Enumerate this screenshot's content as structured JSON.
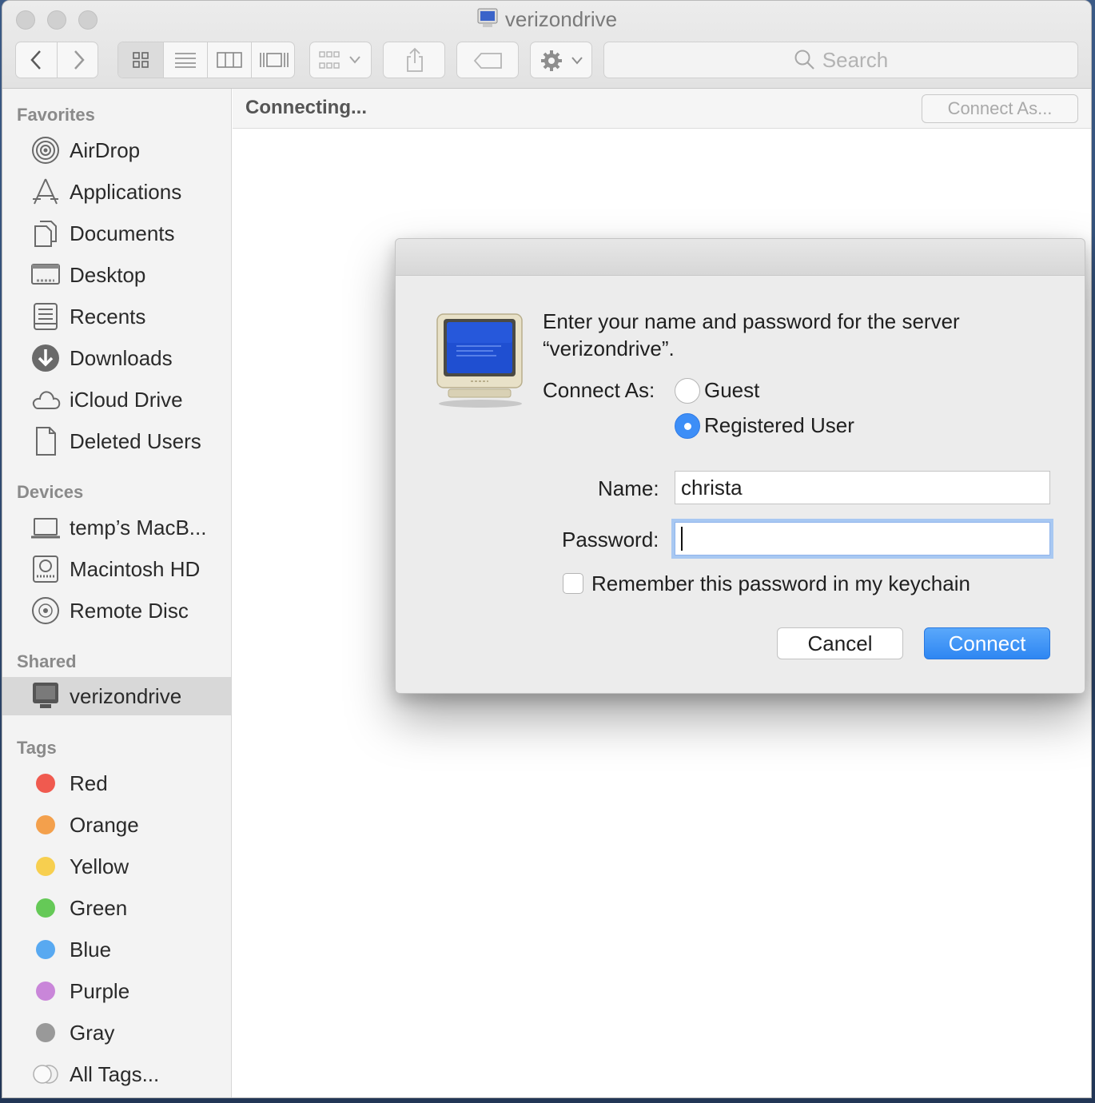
{
  "window": {
    "title": "verizondrive"
  },
  "toolbar": {
    "search_placeholder": "Search"
  },
  "sidebar": {
    "favorites_header": "Favorites",
    "favorites": [
      {
        "label": "AirDrop",
        "icon": "airdrop-icon"
      },
      {
        "label": "Applications",
        "icon": "applications-icon"
      },
      {
        "label": "Documents",
        "icon": "documents-icon"
      },
      {
        "label": "Desktop",
        "icon": "desktop-icon"
      },
      {
        "label": "Recents",
        "icon": "recents-icon"
      },
      {
        "label": "Downloads",
        "icon": "downloads-icon"
      },
      {
        "label": "iCloud Drive",
        "icon": "icloud-icon"
      },
      {
        "label": "Deleted Users",
        "icon": "document-icon"
      }
    ],
    "devices_header": "Devices",
    "devices": [
      {
        "label": "temp’s MacB...",
        "icon": "laptop-icon"
      },
      {
        "label": "Macintosh HD",
        "icon": "hard-drive-icon"
      },
      {
        "label": "Remote Disc",
        "icon": "disc-icon"
      }
    ],
    "shared_header": "Shared",
    "shared": [
      {
        "label": "verizondrive",
        "icon": "monitor-icon",
        "selected": true
      }
    ],
    "tags_header": "Tags",
    "tags": [
      {
        "label": "Red",
        "color": "#f05a4f"
      },
      {
        "label": "Orange",
        "color": "#f3a04c"
      },
      {
        "label": "Yellow",
        "color": "#f7cf4f"
      },
      {
        "label": "Green",
        "color": "#65c957"
      },
      {
        "label": "Blue",
        "color": "#58a9f1"
      },
      {
        "label": "Purple",
        "color": "#c986d9"
      },
      {
        "label": "Gray",
        "color": "#999999"
      },
      {
        "label": "All Tags...",
        "color": ""
      }
    ]
  },
  "pathbar": {
    "status": "Connecting...",
    "connect_as_button": "Connect As..."
  },
  "dialog": {
    "prompt_line1": "Enter your name and password for the server",
    "prompt_line2": "“verizondrive”.",
    "connect_as_label": "Connect As:",
    "guest_label": "Guest",
    "registered_label": "Registered User",
    "selected_option": "Registered User",
    "name_label": "Name:",
    "name_value": "christa",
    "password_label": "Password:",
    "password_value": "",
    "remember_label": "Remember this password in my keychain",
    "remember_checked": false,
    "cancel_button": "Cancel",
    "connect_button": "Connect"
  },
  "colors": {
    "accent": "#3d8ef7",
    "sidebar_bg": "#f3f3f3",
    "selected_row": "#d8d8d8"
  }
}
